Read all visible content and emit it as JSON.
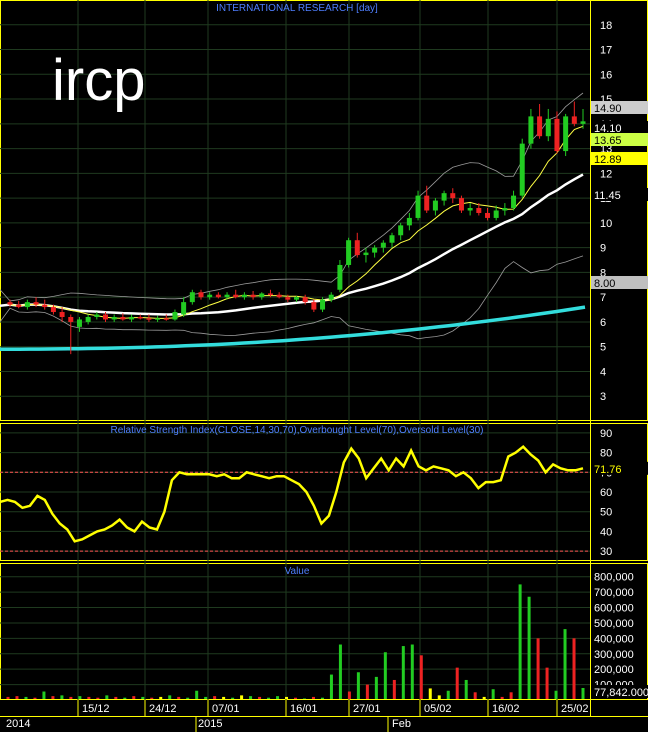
{
  "ticker": "ircp",
  "panels": {
    "price": {
      "title": "INTERNATIONAL RESEARCH [day]"
    },
    "rsi": {
      "title": "Relative Strength Index(CLOSE,14,30,70),Overbought Level(70),Oversold Level(30)"
    },
    "value": {
      "title": "Value"
    }
  },
  "colors": {
    "background": "#000000",
    "grid": "#1f3a1f",
    "panel_border": "#ffff00",
    "axis_text": "#ffffff",
    "title_text": "#4f7fff",
    "up_candle": "#22cc22",
    "down_candle": "#ee2222",
    "ma_long": "#33dddd",
    "ma_mid": "#ffffff",
    "ma_short": "#ffff44",
    "bollinger": "#9a9a9a",
    "rsi_line": "#ffff00",
    "rsi_levels": "#ff5555",
    "volume_up": "#22cc22",
    "volume_down": "#ee2222",
    "volume_neutral": "#ffff00"
  },
  "chart_data": [
    {
      "type": "candlestick",
      "title": "INTERNATIONAL RESEARCH [day]",
      "ylim": [
        2,
        19
      ],
      "y_ticks": [
        3,
        4,
        5,
        6,
        7,
        8,
        9,
        10,
        11,
        12,
        13,
        14,
        15,
        16,
        17,
        18
      ],
      "candles": [
        [
          6.8,
          6.9,
          6.6,
          6.7
        ],
        [
          6.7,
          6.85,
          6.55,
          6.6
        ],
        [
          6.6,
          6.9,
          6.5,
          6.8
        ],
        [
          6.8,
          7.0,
          6.6,
          6.7
        ],
        [
          6.7,
          6.9,
          6.5,
          6.6
        ],
        [
          6.6,
          6.7,
          6.3,
          6.4
        ],
        [
          6.4,
          6.6,
          6.0,
          6.2
        ],
        [
          6.2,
          6.3,
          4.7,
          6.0
        ],
        [
          5.8,
          6.2,
          5.6,
          6.1
        ],
        [
          6.0,
          6.3,
          5.9,
          6.2
        ],
        [
          6.2,
          6.4,
          6.1,
          6.3
        ],
        [
          6.3,
          6.4,
          6.0,
          6.1
        ],
        [
          6.1,
          6.3,
          6.0,
          6.2
        ],
        [
          6.2,
          6.35,
          6.05,
          6.1
        ],
        [
          6.1,
          6.3,
          6.0,
          6.2
        ],
        [
          6.2,
          6.3,
          6.1,
          6.15
        ],
        [
          6.15,
          6.3,
          6.0,
          6.1
        ],
        [
          6.1,
          6.25,
          6.0,
          6.15
        ],
        [
          6.15,
          6.3,
          6.05,
          6.1
        ],
        [
          6.1,
          6.5,
          6.05,
          6.4
        ],
        [
          6.3,
          7.0,
          6.2,
          6.8
        ],
        [
          6.8,
          7.3,
          6.7,
          7.2
        ],
        [
          7.2,
          7.3,
          6.9,
          7.0
        ],
        [
          7.0,
          7.2,
          6.9,
          7.1
        ],
        [
          7.1,
          7.2,
          6.95,
          7.0
        ],
        [
          7.0,
          7.2,
          6.9,
          7.1
        ],
        [
          7.1,
          7.3,
          6.95,
          7.0
        ],
        [
          7.0,
          7.2,
          6.9,
          7.1
        ],
        [
          7.1,
          7.25,
          6.9,
          7.0
        ],
        [
          7.0,
          7.2,
          6.9,
          7.15
        ],
        [
          7.15,
          7.3,
          7.0,
          7.1
        ],
        [
          7.1,
          7.2,
          6.95,
          7.0
        ],
        [
          7.0,
          7.1,
          6.8,
          6.9
        ],
        [
          6.9,
          7.05,
          6.8,
          7.0
        ],
        [
          7.0,
          7.1,
          6.7,
          6.8
        ],
        [
          6.8,
          6.9,
          6.4,
          6.5
        ],
        [
          6.5,
          7.0,
          6.4,
          6.9
        ],
        [
          6.9,
          7.2,
          6.8,
          7.1
        ],
        [
          7.3,
          8.5,
          7.2,
          8.3
        ],
        [
          8.3,
          9.4,
          8.2,
          9.3
        ],
        [
          9.3,
          9.6,
          8.6,
          8.7
        ],
        [
          8.7,
          9.0,
          8.4,
          8.8
        ],
        [
          8.8,
          9.1,
          8.6,
          9.0
        ],
        [
          9.0,
          9.3,
          8.8,
          9.2
        ],
        [
          9.2,
          9.6,
          9.0,
          9.5
        ],
        [
          9.5,
          10.0,
          9.3,
          9.9
        ],
        [
          9.9,
          10.4,
          9.7,
          10.2
        ],
        [
          10.2,
          11.3,
          10.1,
          11.1
        ],
        [
          11.1,
          11.5,
          10.4,
          10.5
        ],
        [
          10.5,
          11.0,
          10.3,
          10.9
        ],
        [
          10.9,
          11.3,
          10.7,
          11.2
        ],
        [
          11.2,
          11.4,
          10.8,
          11.0
        ],
        [
          11.0,
          11.1,
          10.4,
          10.5
        ],
        [
          10.5,
          10.8,
          10.3,
          10.6
        ],
        [
          10.6,
          10.8,
          10.3,
          10.4
        ],
        [
          10.4,
          10.6,
          10.1,
          10.2
        ],
        [
          10.2,
          10.7,
          10.1,
          10.5
        ],
        [
          10.5,
          10.8,
          10.3,
          10.6
        ],
        [
          10.6,
          11.3,
          10.5,
          11.1
        ],
        [
          11.1,
          13.4,
          11.0,
          13.2
        ],
        [
          13.2,
          14.6,
          13.0,
          14.3
        ],
        [
          14.3,
          14.8,
          13.4,
          13.5
        ],
        [
          13.5,
          14.6,
          13.3,
          14.2
        ],
        [
          14.2,
          14.5,
          12.8,
          12.9
        ],
        [
          12.9,
          14.4,
          12.7,
          14.3
        ],
        [
          14.3,
          14.9,
          13.9,
          14.0
        ],
        [
          14.0,
          14.6,
          13.8,
          14.1
        ]
      ],
      "ma_long": {
        "period": "long",
        "start": 4.9,
        "end": 6.6
      },
      "ma_mid": {
        "period": "mid",
        "start": 6.7,
        "end": 11.45
      },
      "last_labels": [
        {
          "value": "14.90",
          "color": "#cccccc",
          "text_color": "#000000"
        },
        {
          "value": "14.10",
          "color": "#000000",
          "text_color": "#ffffff"
        },
        {
          "value": "13.65",
          "color": "#ccff44",
          "text_color": "#000000"
        },
        {
          "value": "12.89",
          "color": "#ffff00",
          "text_color": "#000000"
        },
        {
          "value": "11.45",
          "color": "#000000",
          "text_color": "#ffffff"
        },
        {
          "value": "8.00",
          "color": "#bfbfbf",
          "text_color": "#000000"
        }
      ]
    },
    {
      "type": "line",
      "title": "Relative Strength Index(CLOSE,14,30,70),Overbought Level(70),Oversold Level(30)",
      "ylim": [
        25,
        95
      ],
      "y_ticks": [
        30,
        40,
        50,
        60,
        70,
        80,
        90
      ],
      "levels": [
        70,
        30
      ],
      "values": [
        55,
        56,
        55,
        52,
        53,
        58,
        56,
        49,
        44,
        41,
        35,
        36,
        38,
        40,
        41,
        43,
        46,
        42,
        40,
        45,
        42,
        41,
        50,
        66,
        70,
        69,
        69,
        69,
        69,
        68,
        69,
        67,
        67,
        70,
        69,
        68,
        67,
        68,
        68,
        66,
        64,
        60,
        53,
        44,
        48,
        60,
        75,
        82,
        77,
        67,
        72,
        77,
        71,
        77,
        73,
        81,
        73,
        71,
        73,
        72,
        71,
        68,
        70,
        67,
        62,
        65,
        65,
        66,
        78,
        80,
        83,
        79,
        76,
        70,
        74,
        72,
        71,
        71,
        72
      ],
      "last_label": "71.76"
    },
    {
      "type": "bar",
      "title": "Value",
      "ylim": [
        0,
        850000
      ],
      "y_ticks": [
        100000,
        200000,
        300000,
        400000,
        500000,
        600000,
        700000,
        800000
      ],
      "y_tick_labels": [
        "100,000",
        "200,000",
        "300,000",
        "400,000",
        "500,000",
        "600,000",
        "700,000",
        "800,000"
      ],
      "values": [
        20000,
        25000,
        20000,
        15000,
        55000,
        25000,
        30000,
        20000,
        25000,
        20000,
        15000,
        30000,
        20000,
        15000,
        25000,
        20000,
        15000,
        20000,
        30000,
        20000,
        15000,
        60000,
        20000,
        25000,
        20000,
        15000,
        30000,
        25000,
        20000,
        15000,
        25000,
        20000,
        15000,
        10000,
        20000,
        15000,
        165000,
        360000,
        55000,
        180000,
        100000,
        150000,
        310000,
        130000,
        350000,
        360000,
        290000,
        75000,
        30000,
        60000,
        210000,
        130000,
        50000,
        20000,
        70000,
        20000,
        50000,
        750000,
        670000,
        400000,
        210000,
        60000,
        460000,
        400000,
        78000
      ],
      "colors": [
        "r",
        "r",
        "g",
        "r",
        "g",
        "r",
        "g",
        "r",
        "g",
        "r",
        "r",
        "g",
        "r",
        "g",
        "r",
        "g",
        "r",
        "y",
        "g",
        "r",
        "g",
        "g",
        "g",
        "r",
        "y",
        "g",
        "y",
        "g",
        "r",
        "g",
        "g",
        "y",
        "r",
        "g",
        "r",
        "g",
        "g",
        "g",
        "r",
        "g",
        "r",
        "g",
        "g",
        "r",
        "g",
        "g",
        "r",
        "y",
        "y",
        "g",
        "r",
        "g",
        "r",
        "y",
        "g",
        "r",
        "r",
        "g",
        "g",
        "r",
        "r",
        "g",
        "g",
        "r",
        "g"
      ],
      "last_label": "77,842.000"
    }
  ],
  "x_axis": {
    "years": [
      "2014",
      "2015"
    ],
    "months": [
      "Feb"
    ],
    "dates": [
      "15/12",
      "24/12",
      "07/01",
      "16/01",
      "27/01",
      "05/02",
      "16/02",
      "25/02"
    ]
  }
}
